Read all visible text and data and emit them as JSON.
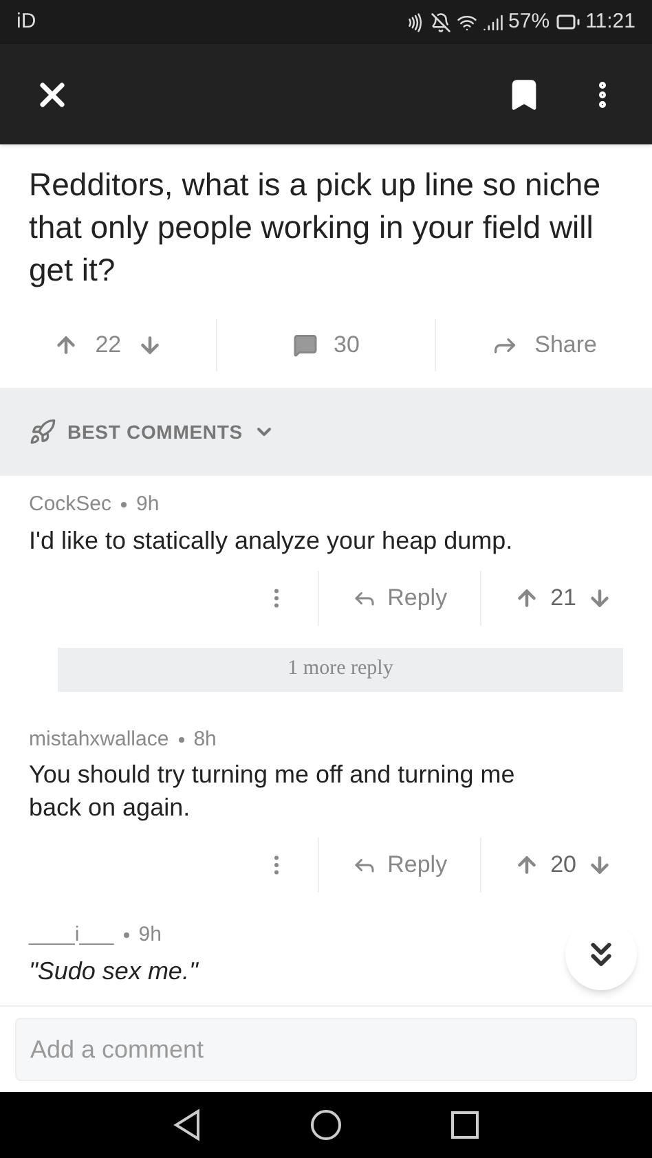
{
  "status_bar": {
    "carrier": "iD",
    "battery": "57%",
    "time": "11:21"
  },
  "post": {
    "title": "Redditors, what is a pick up line so niche that only people working in your field will get it?",
    "score": "22",
    "comments": "30",
    "share": "Share"
  },
  "sort": {
    "label": "BEST COMMENTS"
  },
  "comments": [
    {
      "author": "CockSec",
      "age": "9h",
      "body": "I'd like to statically analyze your heap dump.",
      "italic": false,
      "reply": "Reply",
      "score": "21",
      "more": "1 more reply"
    },
    {
      "author": "mistahxwallace",
      "age": "8h",
      "body": "You should try turning me off and turning me back on again.",
      "italic": false,
      "reply": "Reply",
      "score": "20"
    },
    {
      "author": "____i___",
      "age": "9h",
      "body": "\"Sudo sex me.\"",
      "italic": true
    }
  ],
  "composer": {
    "placeholder": "Add a comment"
  }
}
